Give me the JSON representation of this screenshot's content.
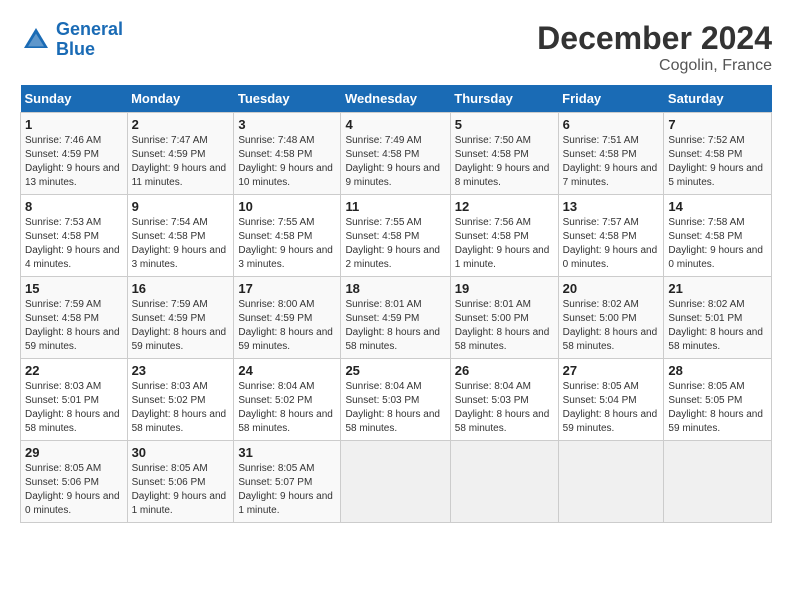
{
  "header": {
    "logo_line1": "General",
    "logo_line2": "Blue",
    "main_title": "December 2024",
    "subtitle": "Cogolin, France"
  },
  "calendar": {
    "days_of_week": [
      "Sunday",
      "Monday",
      "Tuesday",
      "Wednesday",
      "Thursday",
      "Friday",
      "Saturday"
    ],
    "weeks": [
      [
        {
          "day": "1",
          "sunrise": "7:46 AM",
          "sunset": "4:59 PM",
          "daylight": "9 hours and 13 minutes."
        },
        {
          "day": "2",
          "sunrise": "7:47 AM",
          "sunset": "4:59 PM",
          "daylight": "9 hours and 11 minutes."
        },
        {
          "day": "3",
          "sunrise": "7:48 AM",
          "sunset": "4:58 PM",
          "daylight": "9 hours and 10 minutes."
        },
        {
          "day": "4",
          "sunrise": "7:49 AM",
          "sunset": "4:58 PM",
          "daylight": "9 hours and 9 minutes."
        },
        {
          "day": "5",
          "sunrise": "7:50 AM",
          "sunset": "4:58 PM",
          "daylight": "9 hours and 8 minutes."
        },
        {
          "day": "6",
          "sunrise": "7:51 AM",
          "sunset": "4:58 PM",
          "daylight": "9 hours and 7 minutes."
        },
        {
          "day": "7",
          "sunrise": "7:52 AM",
          "sunset": "4:58 PM",
          "daylight": "9 hours and 5 minutes."
        }
      ],
      [
        {
          "day": "8",
          "sunrise": "7:53 AM",
          "sunset": "4:58 PM",
          "daylight": "9 hours and 4 minutes."
        },
        {
          "day": "9",
          "sunrise": "7:54 AM",
          "sunset": "4:58 PM",
          "daylight": "9 hours and 3 minutes."
        },
        {
          "day": "10",
          "sunrise": "7:55 AM",
          "sunset": "4:58 PM",
          "daylight": "9 hours and 3 minutes."
        },
        {
          "day": "11",
          "sunrise": "7:55 AM",
          "sunset": "4:58 PM",
          "daylight": "9 hours and 2 minutes."
        },
        {
          "day": "12",
          "sunrise": "7:56 AM",
          "sunset": "4:58 PM",
          "daylight": "9 hours and 1 minute."
        },
        {
          "day": "13",
          "sunrise": "7:57 AM",
          "sunset": "4:58 PM",
          "daylight": "9 hours and 0 minutes."
        },
        {
          "day": "14",
          "sunrise": "7:58 AM",
          "sunset": "4:58 PM",
          "daylight": "9 hours and 0 minutes."
        }
      ],
      [
        {
          "day": "15",
          "sunrise": "7:59 AM",
          "sunset": "4:58 PM",
          "daylight": "8 hours and 59 minutes."
        },
        {
          "day": "16",
          "sunrise": "7:59 AM",
          "sunset": "4:59 PM",
          "daylight": "8 hours and 59 minutes."
        },
        {
          "day": "17",
          "sunrise": "8:00 AM",
          "sunset": "4:59 PM",
          "daylight": "8 hours and 59 minutes."
        },
        {
          "day": "18",
          "sunrise": "8:01 AM",
          "sunset": "4:59 PM",
          "daylight": "8 hours and 58 minutes."
        },
        {
          "day": "19",
          "sunrise": "8:01 AM",
          "sunset": "5:00 PM",
          "daylight": "8 hours and 58 minutes."
        },
        {
          "day": "20",
          "sunrise": "8:02 AM",
          "sunset": "5:00 PM",
          "daylight": "8 hours and 58 minutes."
        },
        {
          "day": "21",
          "sunrise": "8:02 AM",
          "sunset": "5:01 PM",
          "daylight": "8 hours and 58 minutes."
        }
      ],
      [
        {
          "day": "22",
          "sunrise": "8:03 AM",
          "sunset": "5:01 PM",
          "daylight": "8 hours and 58 minutes."
        },
        {
          "day": "23",
          "sunrise": "8:03 AM",
          "sunset": "5:02 PM",
          "daylight": "8 hours and 58 minutes."
        },
        {
          "day": "24",
          "sunrise": "8:04 AM",
          "sunset": "5:02 PM",
          "daylight": "8 hours and 58 minutes."
        },
        {
          "day": "25",
          "sunrise": "8:04 AM",
          "sunset": "5:03 PM",
          "daylight": "8 hours and 58 minutes."
        },
        {
          "day": "26",
          "sunrise": "8:04 AM",
          "sunset": "5:03 PM",
          "daylight": "8 hours and 58 minutes."
        },
        {
          "day": "27",
          "sunrise": "8:05 AM",
          "sunset": "5:04 PM",
          "daylight": "8 hours and 59 minutes."
        },
        {
          "day": "28",
          "sunrise": "8:05 AM",
          "sunset": "5:05 PM",
          "daylight": "8 hours and 59 minutes."
        }
      ],
      [
        {
          "day": "29",
          "sunrise": "8:05 AM",
          "sunset": "5:06 PM",
          "daylight": "9 hours and 0 minutes."
        },
        {
          "day": "30",
          "sunrise": "8:05 AM",
          "sunset": "5:06 PM",
          "daylight": "9 hours and 1 minute."
        },
        {
          "day": "31",
          "sunrise": "8:05 AM",
          "sunset": "5:07 PM",
          "daylight": "9 hours and 1 minute."
        },
        null,
        null,
        null,
        null
      ]
    ]
  }
}
